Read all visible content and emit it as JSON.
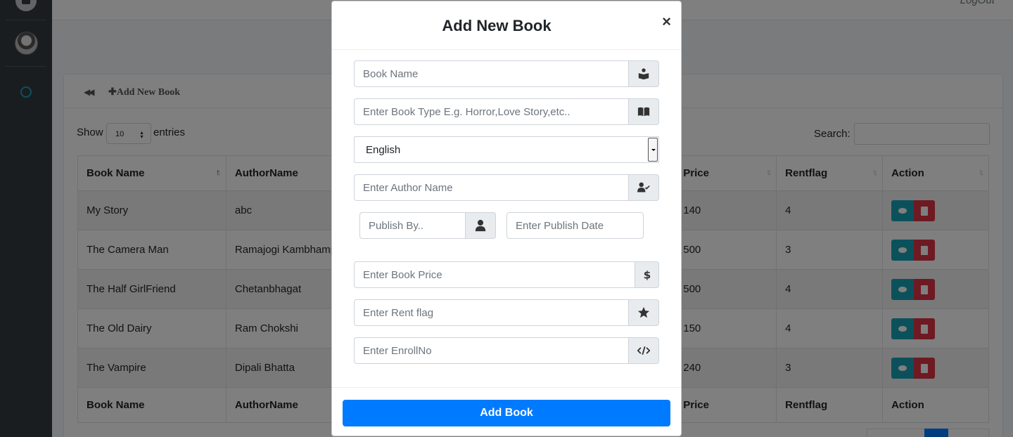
{
  "header": {
    "logout_label": "LogOut"
  },
  "card": {
    "add_link": "Add New Book"
  },
  "datatable": {
    "show_label": "Show",
    "entries_value": "10",
    "entries_label": "entries",
    "search_label": "Search:",
    "columns": [
      "Book Name",
      "AuthorName",
      "Price",
      "Rentflag",
      "Action"
    ],
    "rows": [
      {
        "book": "My Story",
        "author": "abc",
        "price": "140",
        "rentflag": "4"
      },
      {
        "book": "The Camera Man",
        "author": "Ramajogi Kambhampati",
        "price": "500",
        "rentflag": "3"
      },
      {
        "book": "The Half GirlFriend",
        "author": "Chetanbhagat",
        "price": "500",
        "rentflag": "4"
      },
      {
        "book": "The Old Dairy",
        "author": "Ram Chokshi",
        "price": "150",
        "rentflag": "4"
      },
      {
        "book": "The Vampire",
        "author": "Dipali Bhatta",
        "price": "240",
        "rentflag": "3"
      }
    ]
  },
  "modal": {
    "title": "Add New Book",
    "close_label": "×",
    "fields": {
      "book_name_placeholder": "Book Name",
      "book_type_placeholder": "Enter Book Type E.g. Horror,Love Story,etc..",
      "language_value": "English",
      "author_placeholder": "Enter Author Name",
      "publish_by_placeholder": "Publish By..",
      "publish_date_placeholder": "Enter Publish Date",
      "price_placeholder": "Enter Book Price",
      "rent_flag_placeholder": "Enter Rent flag",
      "enroll_placeholder": "Enter EnrollNo"
    },
    "submit_label": "Add Book"
  },
  "colors": {
    "primary": "#007bff",
    "info": "#17a2b8",
    "danger": "#dc3545",
    "sidebar": "#343a40"
  }
}
